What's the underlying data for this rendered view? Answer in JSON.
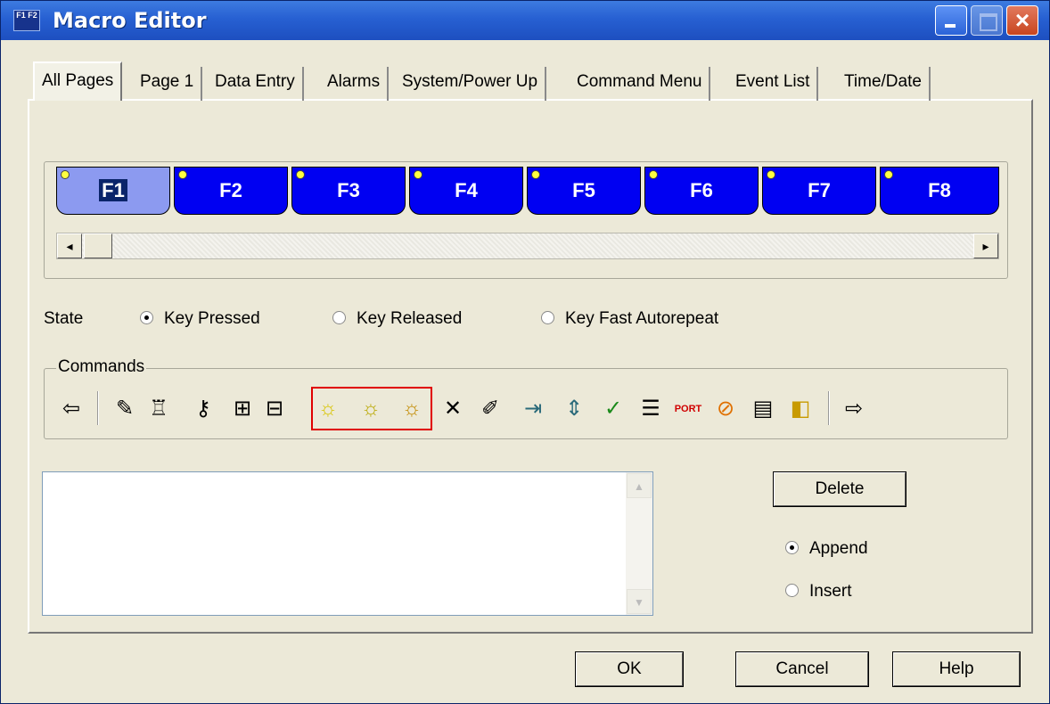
{
  "window": {
    "title": "Macro Editor",
    "icon_text": "F1 F2"
  },
  "tabs": [
    {
      "label": "All Pages",
      "active": true
    },
    {
      "label": "Page 1"
    },
    {
      "label": "Data Entry"
    },
    {
      "label": "Alarms"
    },
    {
      "label": "System/Power Up"
    },
    {
      "label": "Command Menu"
    },
    {
      "label": "Event List"
    },
    {
      "label": "Time/Date"
    }
  ],
  "function_keys": [
    {
      "label": "F1",
      "selected": true
    },
    {
      "label": "F2"
    },
    {
      "label": "F3"
    },
    {
      "label": "F4"
    },
    {
      "label": "F5"
    },
    {
      "label": "F6"
    },
    {
      "label": "F7"
    },
    {
      "label": "F8"
    }
  ],
  "scroll": {
    "left_arrow": "◂",
    "right_arrow": "▸"
  },
  "state": {
    "label": "State",
    "options": [
      {
        "label": "Key Pressed",
        "selected": true
      },
      {
        "label": "Key Released",
        "selected": false
      },
      {
        "label": "Key Fast Autorepeat",
        "selected": false
      }
    ]
  },
  "commands": {
    "legend": "Commands",
    "icons": [
      {
        "name": "arrow-left-icon",
        "glyph": "⇦"
      },
      {
        "name": "pencil-icon",
        "glyph": "✎"
      },
      {
        "name": "bucket-wrench-icon",
        "glyph": "♖"
      },
      {
        "name": "key-icon",
        "glyph": "⚷"
      },
      {
        "name": "insert-column-icon",
        "glyph": "⊞"
      },
      {
        "name": "delete-column-icon",
        "glyph": "⊟"
      },
      {
        "name": "light-on-icon",
        "glyph": "☼"
      },
      {
        "name": "light-off-icon",
        "glyph": "☼"
      },
      {
        "name": "light-flash-icon",
        "glyph": "☼"
      },
      {
        "name": "cross-icon",
        "glyph": "✕"
      },
      {
        "name": "edit-tool-icon",
        "glyph": "✐"
      },
      {
        "name": "goto-page-icon",
        "glyph": "⇥"
      },
      {
        "name": "page-scroll-icon",
        "glyph": "⇕"
      },
      {
        "name": "page-check-icon",
        "glyph": "✓"
      },
      {
        "name": "list-icon",
        "glyph": "☰"
      },
      {
        "name": "port-icon",
        "glyph": "PORT"
      },
      {
        "name": "stop-sign-icon",
        "glyph": "⊘"
      },
      {
        "name": "device-icon",
        "glyph": "▤"
      },
      {
        "name": "sound-icon",
        "glyph": "◧"
      },
      {
        "name": "arrow-right-icon",
        "glyph": "⇨"
      }
    ],
    "highlight_color": "#e00000"
  },
  "buttons": {
    "delete": "Delete",
    "ok": "OK",
    "cancel": "Cancel",
    "help": "Help"
  },
  "insert_mode": {
    "options": [
      {
        "label": "Append",
        "selected": true
      },
      {
        "label": "Insert",
        "selected": false
      }
    ]
  },
  "colors": {
    "function_key_blue": "#0000f2",
    "function_key_selected": "#8c9af0",
    "key_dot_yellow": "#ffff40"
  }
}
